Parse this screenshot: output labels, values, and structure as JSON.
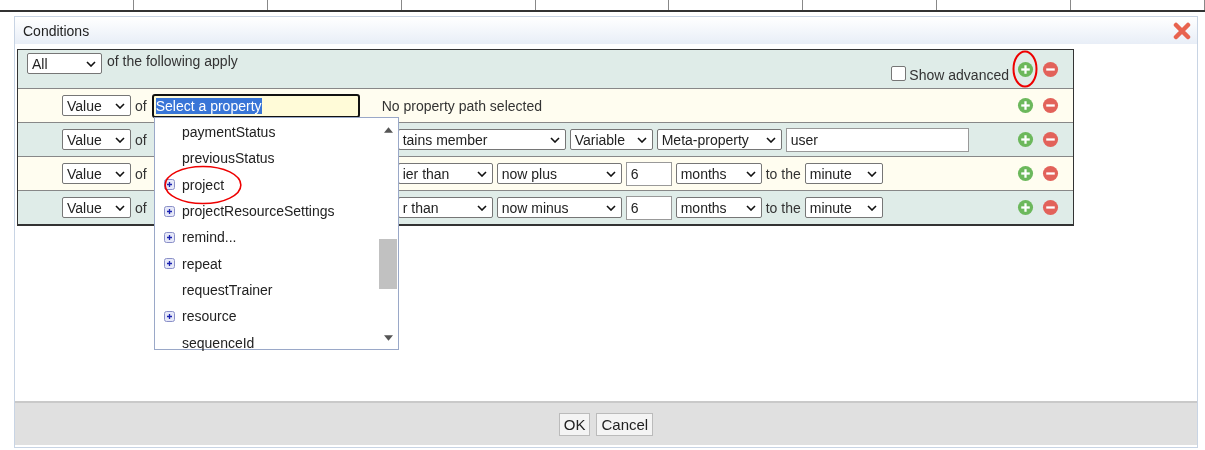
{
  "window": {
    "title": "Conditions"
  },
  "header": {
    "match": "All",
    "text": "of the following apply",
    "show_advanced": {
      "label": "Show advanced",
      "checked": false
    },
    "add_highlighted": true
  },
  "conditions": [
    {
      "parts": [
        {
          "kind": "select",
          "value": "Value"
        },
        {
          "kind": "text",
          "text": "of"
        },
        {
          "kind": "property",
          "value": "Select a property",
          "selected": true
        },
        {
          "kind": "note",
          "text": "No property path selected"
        }
      ]
    },
    {
      "parts": [
        {
          "kind": "select",
          "value": "Value"
        },
        {
          "kind": "text",
          "text": "of"
        },
        {
          "kind": "hidden"
        },
        {
          "kind": "select",
          "value": "tains member"
        },
        {
          "kind": "select",
          "value": "Variable"
        },
        {
          "kind": "select",
          "value": "Meta-property"
        },
        {
          "kind": "input",
          "value": "user"
        }
      ]
    },
    {
      "parts": [
        {
          "kind": "select",
          "value": "Value"
        },
        {
          "kind": "text",
          "text": "of"
        },
        {
          "kind": "hidden"
        },
        {
          "kind": "select",
          "value": "ier than"
        },
        {
          "kind": "select",
          "value": "now plus"
        },
        {
          "kind": "input",
          "value": "6"
        },
        {
          "kind": "select",
          "value": "months"
        },
        {
          "kind": "text",
          "text": "to the"
        },
        {
          "kind": "select",
          "value": "minute"
        }
      ]
    },
    {
      "parts": [
        {
          "kind": "select",
          "value": "Value"
        },
        {
          "kind": "text",
          "text": "of"
        },
        {
          "kind": "hidden"
        },
        {
          "kind": "select",
          "value": "r than"
        },
        {
          "kind": "select",
          "value": "now minus"
        },
        {
          "kind": "input",
          "value": "6"
        },
        {
          "kind": "select",
          "value": "months"
        },
        {
          "kind": "text",
          "text": "to the"
        },
        {
          "kind": "select",
          "value": "minute"
        }
      ]
    }
  ],
  "dropdown": {
    "items": [
      {
        "label": "paymentStatus",
        "expandable": false,
        "highlighted": false
      },
      {
        "label": "previousStatus",
        "expandable": false,
        "highlighted": false
      },
      {
        "label": "project",
        "expandable": true,
        "highlighted": true
      },
      {
        "label": "projectResourceSettings",
        "expandable": true,
        "highlighted": false
      },
      {
        "label": "remind...",
        "expandable": true,
        "highlighted": false
      },
      {
        "label": "repeat",
        "expandable": true,
        "highlighted": false
      },
      {
        "label": "requestTrainer",
        "expandable": false,
        "highlighted": false
      },
      {
        "label": "resource",
        "expandable": true,
        "highlighted": false
      },
      {
        "label": "sequenceId",
        "expandable": false,
        "highlighted": false
      }
    ]
  },
  "buttons": [
    "OK",
    "Cancel"
  ]
}
